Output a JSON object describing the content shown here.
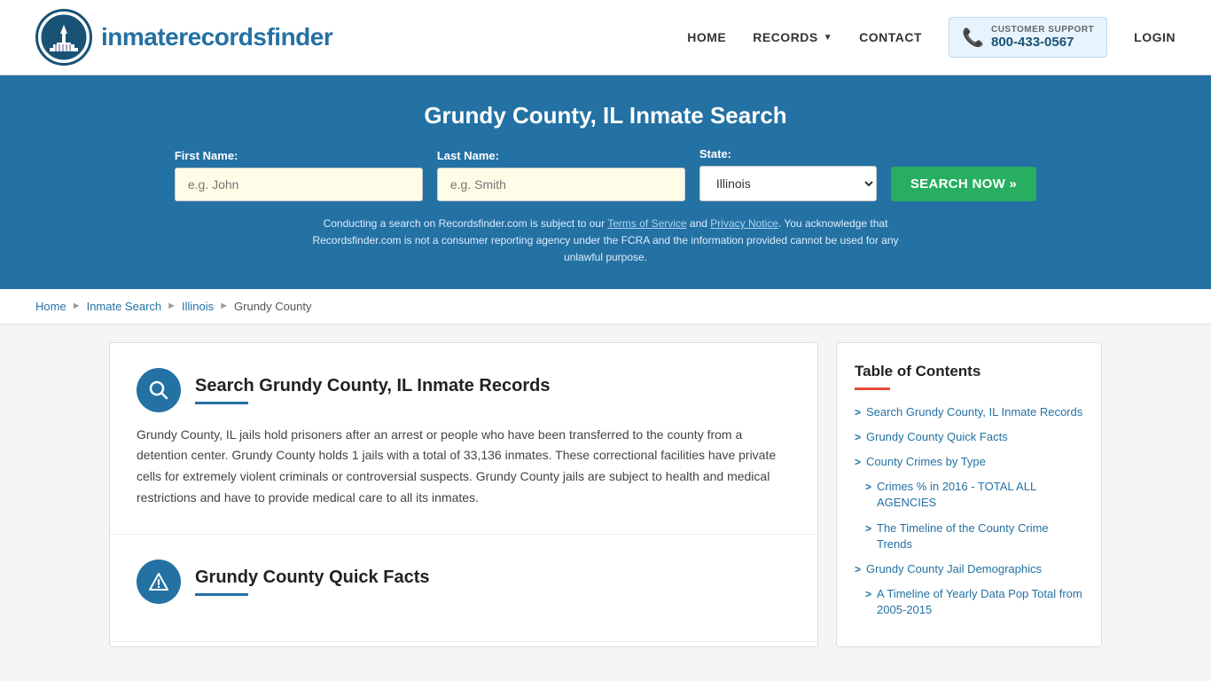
{
  "header": {
    "logo_text_normal": "inmaterecords",
    "logo_text_bold": "finder",
    "nav": {
      "home": "HOME",
      "records": "RECORDS",
      "contact": "CONTACT",
      "login": "LOGIN"
    },
    "support": {
      "label": "CUSTOMER SUPPORT",
      "number": "800-433-0567"
    }
  },
  "banner": {
    "title": "Grundy County, IL Inmate Search",
    "first_name_label": "First Name:",
    "first_name_placeholder": "e.g. John",
    "last_name_label": "Last Name:",
    "last_name_placeholder": "e.g. Smith",
    "state_label": "State:",
    "state_value": "Illinois",
    "search_button": "SEARCH NOW »",
    "disclaimer": "Conducting a search on Recordsfinder.com is subject to our Terms of Service and Privacy Notice. You acknowledge that Recordsfinder.com is not a consumer reporting agency under the FCRA and the information provided cannot be used for any unlawful purpose."
  },
  "breadcrumb": {
    "home": "Home",
    "inmate_search": "Inmate Search",
    "illinois": "Illinois",
    "county": "Grundy County"
  },
  "sections": [
    {
      "id": "search-records",
      "icon": "search",
      "title": "Search Grundy County, IL Inmate Records",
      "body": "Grundy County, IL jails hold prisoners after an arrest or people who have been transferred to the county from a detention center. Grundy County holds 1 jails with a total of 33,136 inmates. These correctional facilities have private cells for extremely violent criminals or controversial suspects. Grundy County jails are subject to health and medical restrictions and have to provide medical care to all its inmates."
    },
    {
      "id": "quick-facts",
      "icon": "alert",
      "title": "Grundy County Quick Facts",
      "body": ""
    }
  ],
  "toc": {
    "title": "Table of Contents",
    "items": [
      {
        "label": "Search Grundy County, IL Inmate Records",
        "sub": false
      },
      {
        "label": "Grundy County Quick Facts",
        "sub": false
      },
      {
        "label": "County Crimes by Type",
        "sub": false
      },
      {
        "label": "Crimes % in 2016 - TOTAL ALL AGENCIES",
        "sub": true
      },
      {
        "label": "The Timeline of the County Crime Trends",
        "sub": true
      },
      {
        "label": "Grundy County Jail Demographics",
        "sub": false
      },
      {
        "label": "A Timeline of Yearly Data Pop Total from 2005-2015",
        "sub": true
      }
    ]
  }
}
